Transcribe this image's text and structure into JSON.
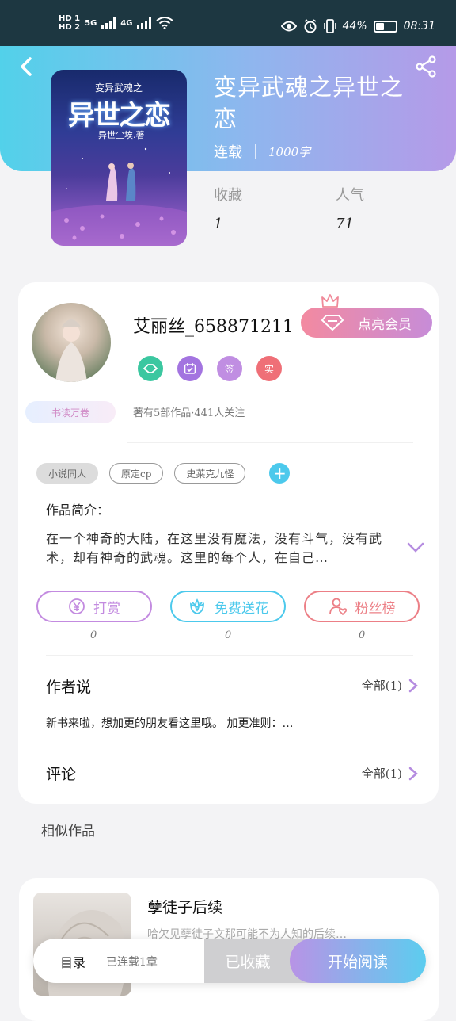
{
  "status_bar": {
    "hd1": "HD 1",
    "hd2": "HD 2",
    "net1": "5G",
    "net2": "4G",
    "battery_text": "44%",
    "time": "08:31",
    "battery_level": 0.44
  },
  "book": {
    "title": "变异武魂之异世之恋",
    "status": "连载",
    "word_count": "1000字",
    "collect_label": "收藏",
    "collect_value": "1",
    "popularity_label": "人气",
    "popularity_value": "71",
    "cover_series": "变异武魂之",
    "cover_title": "异世之恋",
    "cover_author": "异世尘埃.著"
  },
  "author": {
    "name": "艾丽丝_658871211",
    "reader_badge": "书读万卷",
    "vip_button": "点亮会员",
    "badges": [
      "sign-icon",
      "calendar-icon",
      "签",
      "实"
    ],
    "stats": "著有5部作品·441人关注"
  },
  "tags": [
    "小说同人",
    "原定cp",
    "史莱克九怪"
  ],
  "intro": {
    "label": "作品简介：",
    "text": "在一个神奇的大陆，在这里没有魔法，没有斗气，没有武术，却有神奇的武魂。这里的每个人，在自己…"
  },
  "actions": [
    {
      "label": "打赏",
      "count": "0",
      "color": "#c38be0"
    },
    {
      "label": "免费送花",
      "count": "0",
      "color": "#4cc9ec"
    },
    {
      "label": "粉丝榜",
      "count": "0",
      "color": "#ec7f86"
    }
  ],
  "author_say": {
    "title": "作者说",
    "all": "全部(1)",
    "text": "新书来啦，想加更的朋友看这里哦。 加更准则：…"
  },
  "comments": {
    "title": "评论",
    "all": "全部(1)"
  },
  "similar": {
    "label": "相似作品",
    "title": "孽徒子后续",
    "desc": "哈欠见孽徒子文那可能不为人知的后续…"
  },
  "bottom_bar": {
    "toc": "目录",
    "progress": "已连载1章",
    "collected": "已收藏",
    "read": "开始阅读"
  }
}
